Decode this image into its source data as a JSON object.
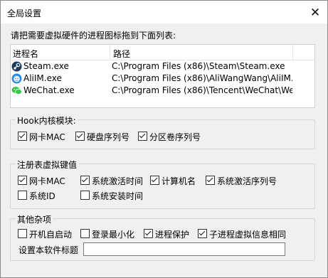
{
  "window": {
    "title": "全局设置"
  },
  "instruction": "请把需要虚拟硬件的进程图标拖到下面列表:",
  "process_list": {
    "columns": [
      "进程名",
      "路径"
    ],
    "rows": [
      {
        "icon": "steam-icon",
        "name": "Steam.exe",
        "path": "C:\\Program Files (x86)\\Steam\\Steam.exe"
      },
      {
        "icon": "aliim-icon",
        "name": "AliIM.exe",
        "path": "C:\\Program Files (x86)\\AliWangWang\\AliIM.exe"
      },
      {
        "icon": "wechat-icon",
        "name": "WeChat.exe",
        "path": "C:\\Program Files (x86)\\Tencent\\WeChat\\WeCha..."
      }
    ]
  },
  "hook_group": {
    "title": "Hook内核模块:",
    "options": [
      {
        "label": "网卡MAC",
        "checked": true
      },
      {
        "label": "硬盘序列号",
        "checked": true
      },
      {
        "label": "分区卷序列号",
        "checked": true
      }
    ]
  },
  "registry_group": {
    "title": "注册表虚拟键值",
    "options": [
      {
        "label": "网卡MAC",
        "checked": true
      },
      {
        "label": "系统激活时间",
        "checked": true
      },
      {
        "label": "计算机名",
        "checked": true
      },
      {
        "label": "系统激活序列号",
        "checked": true
      },
      {
        "label": "系统ID",
        "checked": false
      },
      {
        "label": "系统安装时间",
        "checked": false
      }
    ]
  },
  "misc_group": {
    "title": "其他杂项",
    "options": [
      {
        "label": "开机自启动",
        "checked": false
      },
      {
        "label": "登录最小化",
        "checked": false
      },
      {
        "label": "进程保护",
        "checked": true
      },
      {
        "label": "子进程虚拟信息相同",
        "checked": true
      }
    ],
    "title_field_label": "设置本软件标题",
    "title_field_value": ""
  },
  "colors": {
    "title_bg": "#ffffff",
    "dialog_bg": "#f0f0f0",
    "steam_icon": "#1b3a5c",
    "aliim_icon": "#2a8fe0",
    "wechat_icon": "#35c94a"
  }
}
